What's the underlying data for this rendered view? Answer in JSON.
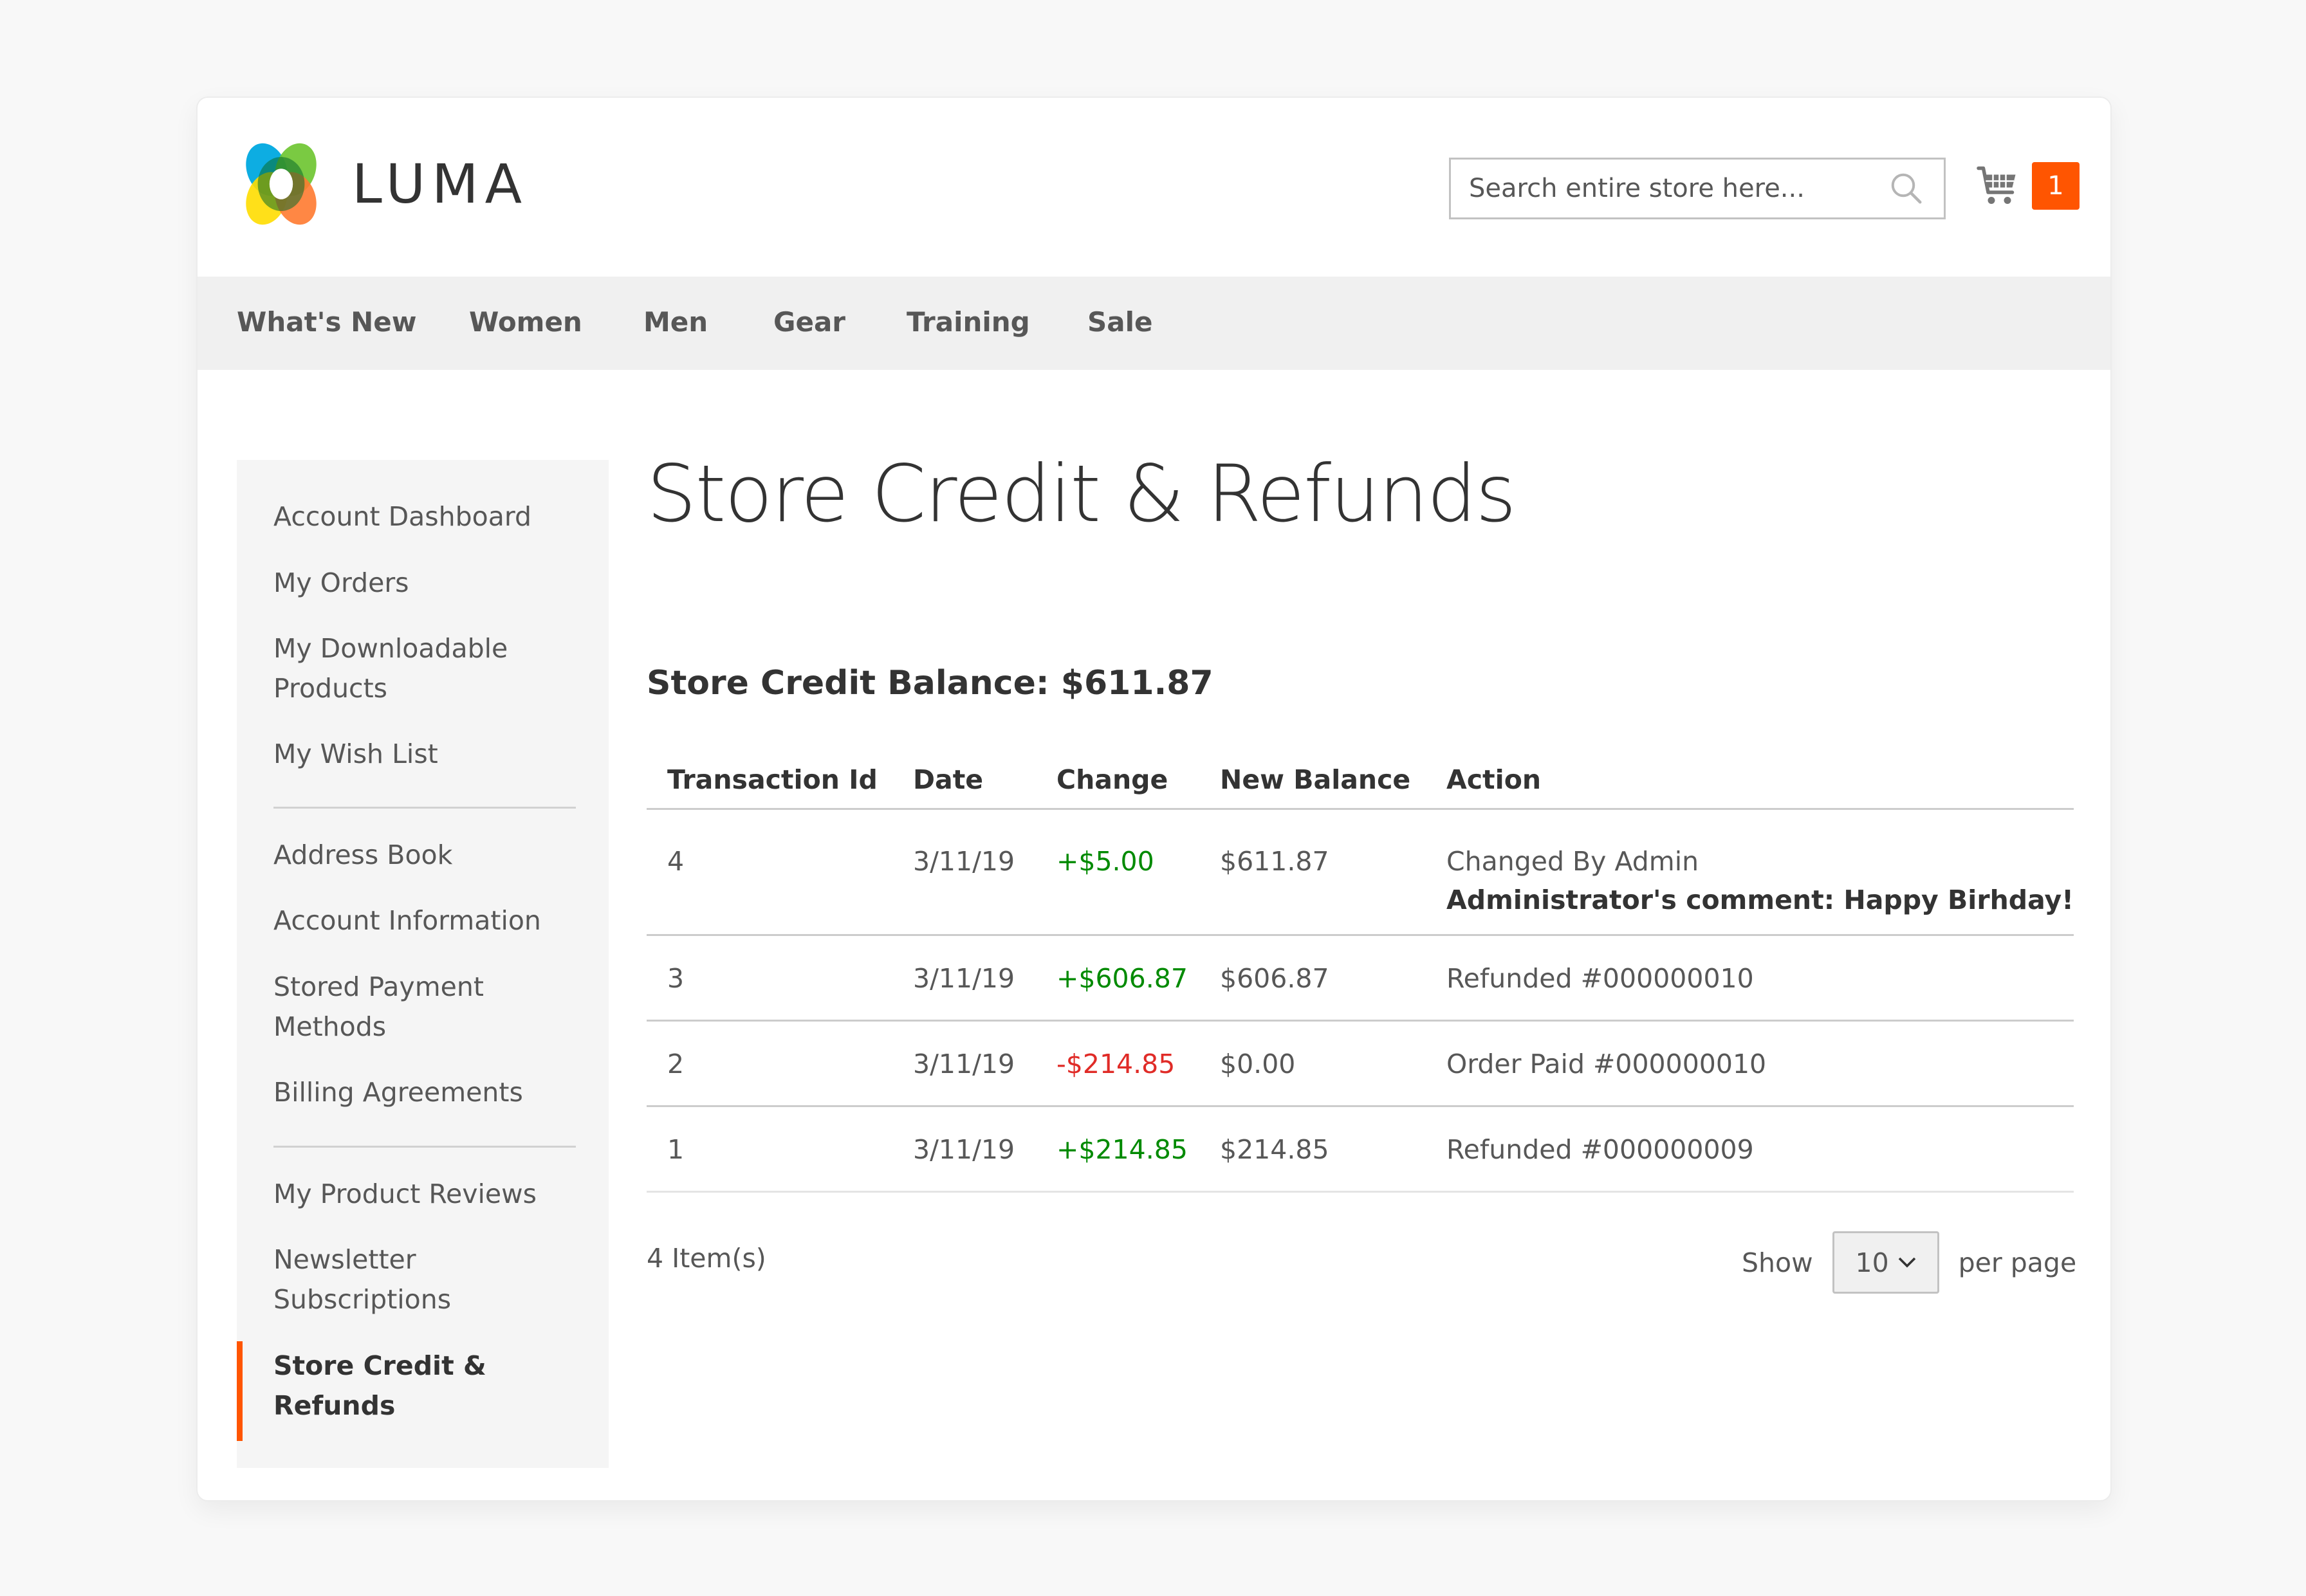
{
  "brand": {
    "name": "LUMA",
    "logo_colors": [
      "#00a9e0",
      "#6cc42e",
      "#ffdd00",
      "#ff7a30"
    ],
    "accent": "#ff5501"
  },
  "header": {
    "search": {
      "placeholder": "Search entire store here...",
      "value": "",
      "icon": "search-icon"
    },
    "cart": {
      "icon": "cart-icon",
      "count": "1"
    }
  },
  "nav": {
    "items": [
      {
        "label": "What's New"
      },
      {
        "label": "Women"
      },
      {
        "label": "Men"
      },
      {
        "label": "Gear"
      },
      {
        "label": "Training"
      },
      {
        "label": "Sale"
      }
    ]
  },
  "sidebar": {
    "groups": [
      [
        "Account Dashboard",
        "My Orders",
        "My Downloadable Products",
        "My Wish List"
      ],
      [
        "Address Book",
        "Account Information",
        "Stored Payment Methods",
        "Billing Agreements"
      ],
      [
        "My Product Reviews",
        "Newsletter Subscriptions",
        "Store Credit & Refunds"
      ]
    ],
    "items": {
      "account_dashboard": "Account Dashboard",
      "my_orders": "My Orders",
      "my_downloadable_products": "My Downloadable Products",
      "my_wish_list": "My Wish List",
      "address_book": "Address Book",
      "account_information": "Account Information",
      "stored_payment_methods": "Stored Payment Methods",
      "billing_agreements": "Billing Agreements",
      "my_product_reviews": "My Product Reviews",
      "newsletter_subscriptions": "Newsletter Subscriptions",
      "store_credit_refunds": "Store Credit & Refunds"
    },
    "active": "Store Credit & Refunds"
  },
  "main": {
    "title": "Store Credit & Refunds",
    "balance_label": "Store Credit Balance: $611.87",
    "table": {
      "columns": [
        "Transaction Id",
        "Date",
        "Change",
        "New Balance",
        "Action"
      ],
      "rows": [
        {
          "id": "4",
          "date": "3/11/19",
          "change": "+$5.00",
          "change_type": "positive",
          "new_balance": "$611.87",
          "action": "Changed By Admin",
          "comment": "Administrator's comment: Happy Birhday!"
        },
        {
          "id": "3",
          "date": "3/11/19",
          "change": "+$606.87",
          "change_type": "positive",
          "new_balance": "$606.87",
          "action": "Refunded #000000010"
        },
        {
          "id": "2",
          "date": "3/11/19",
          "change": "-$214.85",
          "change_type": "negative",
          "new_balance": "$0.00",
          "action": "Order Paid #000000010"
        },
        {
          "id": "1",
          "date": "3/11/19",
          "change": "+$214.85",
          "change_type": "positive",
          "new_balance": "$214.85",
          "action": "Refunded #000000009"
        }
      ]
    },
    "items_count": "4 Item(s)",
    "limiter": {
      "show_label": "Show",
      "selected": "10",
      "per_page_label": "per page"
    }
  },
  "colors": {
    "positive": "#008a00",
    "negative": "#e02b27",
    "nav_bg": "#f0f0f0",
    "sidebar_bg": "#f5f5f5"
  }
}
